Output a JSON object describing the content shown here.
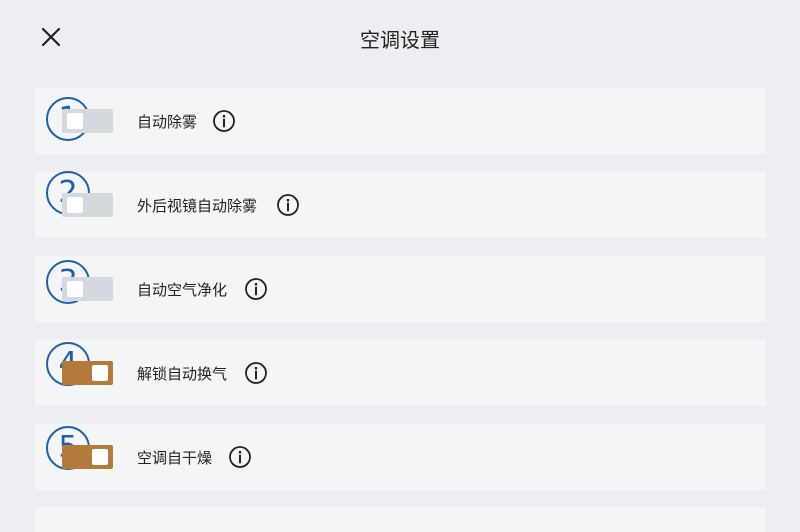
{
  "header": {
    "title": "空调设置",
    "close_icon": "close-icon"
  },
  "settings": [
    {
      "number": "1",
      "label": "自动除雾",
      "enabled": false,
      "info_icon": "info-icon"
    },
    {
      "number": "2",
      "label": "外后视镜自动除雾",
      "enabled": false,
      "info_icon": "info-icon"
    },
    {
      "number": "3",
      "label": "自动空气净化",
      "enabled": false,
      "info_icon": "info-icon"
    },
    {
      "number": "4",
      "label": "解锁自动换气",
      "enabled": true,
      "info_icon": "info-icon"
    },
    {
      "number": "5",
      "label": "空调自干燥",
      "enabled": true,
      "info_icon": "info-icon"
    }
  ],
  "colors": {
    "toggle_on": "#b47a3c",
    "toggle_off": "#d5d8dc",
    "badge": "#1f5fa8"
  }
}
